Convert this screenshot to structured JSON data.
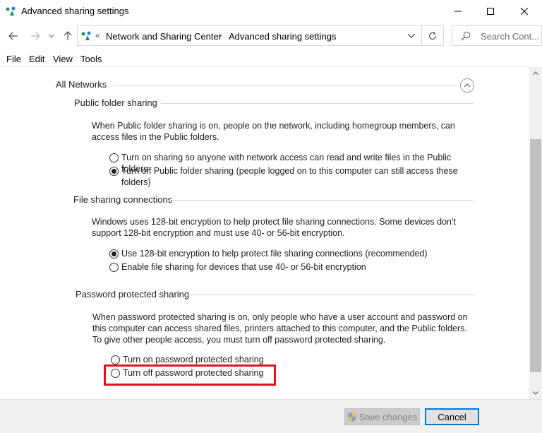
{
  "window": {
    "title": "Advanced sharing settings"
  },
  "address_bar": {
    "separator": "«",
    "crumbs": [
      "Network and Sharing Center",
      "Advanced sharing settings"
    ],
    "crumb_separator": "›"
  },
  "search": {
    "placeholder": "Search Cont..."
  },
  "menu": {
    "items": [
      "File",
      "Edit",
      "View",
      "Tools"
    ]
  },
  "content": {
    "section_title": "All Networks",
    "public_folder": {
      "title": "Public folder sharing",
      "description": "When Public folder sharing is on, people on the network, including homegroup members, can access files in the Public folders.",
      "options": [
        {
          "label": "Turn on sharing so anyone with network access can read and write files in the Public folders",
          "checked": false
        },
        {
          "label": "Turn off Public folder sharing (people logged on to this computer can still access these folders)",
          "checked": true
        }
      ]
    },
    "file_sharing": {
      "title": "File sharing connections",
      "description": "Windows uses 128-bit encryption to help protect file sharing connections. Some devices don't support 128-bit encryption and must use 40- or 56-bit encryption.",
      "options": [
        {
          "label": "Use 128-bit encryption to help protect file sharing connections (recommended)",
          "checked": true
        },
        {
          "label": "Enable file sharing for devices that use 40- or 56-bit encryption",
          "checked": false
        }
      ]
    },
    "password_sharing": {
      "title": "Password protected sharing",
      "description": "When password protected sharing is on, only people who have a user account and password on this computer can access shared files, printers attached to this computer, and the Public folders. To give other people access, you must turn off password protected sharing.",
      "options": [
        {
          "label": "Turn on password protected sharing",
          "checked": false
        },
        {
          "label": "Turn off password protected sharing",
          "checked": false
        }
      ]
    }
  },
  "footer": {
    "save_label": "Save changes",
    "cancel_label": "Cancel"
  },
  "colors": {
    "highlight": "#e0141e",
    "focus_border": "#0078d7"
  }
}
